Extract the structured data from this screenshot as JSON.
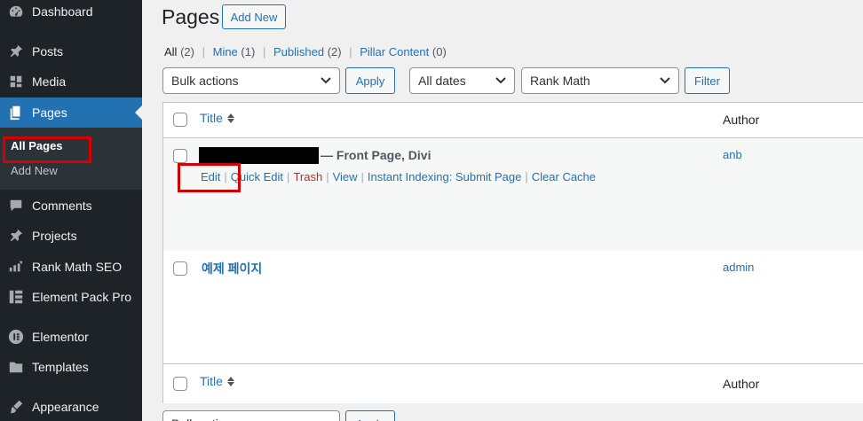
{
  "sidebar": {
    "items": [
      {
        "label": "Dashboard",
        "icon": "dashboard-icon"
      },
      {
        "label": "Posts",
        "icon": "pin-icon"
      },
      {
        "label": "Media",
        "icon": "media-icon"
      },
      {
        "label": "Pages",
        "icon": "pages-icon"
      },
      {
        "label": "Comments",
        "icon": "comment-icon"
      },
      {
        "label": "Projects",
        "icon": "pin-icon"
      },
      {
        "label": "Rank Math SEO",
        "icon": "rank-math-icon"
      },
      {
        "label": "Element Pack Pro",
        "icon": "element-pack-icon"
      },
      {
        "label": "Elementor",
        "icon": "elementor-icon"
      },
      {
        "label": "Templates",
        "icon": "folder-icon"
      },
      {
        "label": "Appearance",
        "icon": "brush-icon"
      }
    ],
    "submenu": {
      "all_pages": "All Pages",
      "add_new": "Add New"
    }
  },
  "header": {
    "title": "Pages",
    "add_new": "Add New"
  },
  "filters": {
    "all": "All",
    "all_count": "(2)",
    "mine": "Mine",
    "mine_count": "(1)",
    "published": "Published",
    "published_count": "(2)",
    "pillar": "Pillar Content",
    "pillar_count": "(0)",
    "sep": "|"
  },
  "toolbar": {
    "bulk_actions": "Bulk actions",
    "apply": "Apply",
    "dates": "All dates",
    "rank_math": "Rank Math",
    "filter": "Filter"
  },
  "table": {
    "col_title": "Title",
    "col_author": "Author",
    "rows": [
      {
        "title_suffix": "— Front Page, Divi",
        "author": "anb",
        "actions": {
          "edit": "Edit",
          "quick_edit": "Quick Edit",
          "trash": "Trash",
          "view": "View",
          "indexing": "Instant Indexing: Submit Page",
          "clear_cache": "Clear Cache",
          "sep": "|"
        }
      },
      {
        "title": "예제 페이지",
        "author": "admin"
      }
    ]
  },
  "colors": {
    "sidebar_bg": "#1d2327",
    "accent": "#2271b1",
    "highlight_box": "#d40000",
    "trash": "#b32d2e"
  }
}
